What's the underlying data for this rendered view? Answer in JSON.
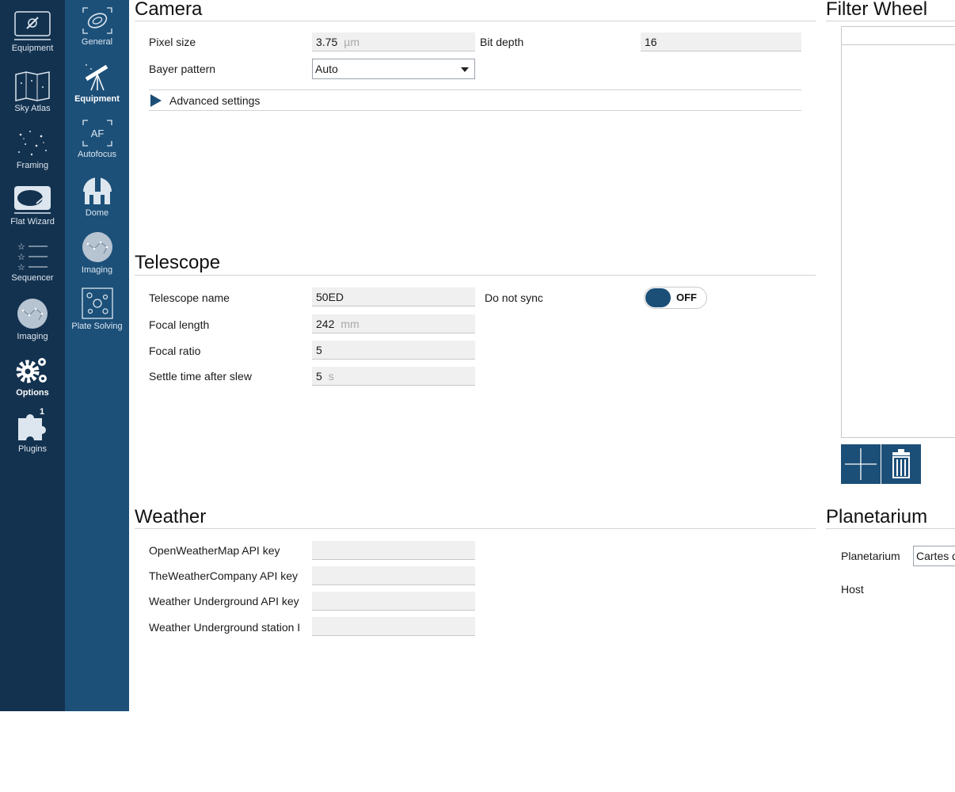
{
  "nav_main": [
    {
      "label": "Equipment",
      "icon": "plug-icon"
    },
    {
      "label": "Sky Atlas",
      "icon": "map-icon"
    },
    {
      "label": "Framing",
      "icon": "stars-icon"
    },
    {
      "label": "Flat Wizard",
      "icon": "flat-wizard-icon"
    },
    {
      "label": "Sequencer",
      "icon": "sequence-list-icon"
    },
    {
      "label": "Imaging",
      "icon": "constellation-icon"
    },
    {
      "label": "Options",
      "icon": "gears-icon",
      "active": true
    },
    {
      "label": "Plugins",
      "icon": "puzzle-icon",
      "badge": "1"
    }
  ],
  "nav_sub": [
    {
      "label": "General",
      "icon": "galaxy-icon"
    },
    {
      "label": "Equipment",
      "icon": "telescope-icon",
      "active": true
    },
    {
      "label": "Autofocus",
      "icon": "autofocus-icon",
      "text": "AF"
    },
    {
      "label": "Dome",
      "icon": "observatory-icon"
    },
    {
      "label": "Imaging",
      "icon": "constellation-icon"
    },
    {
      "label": "Plate Solving",
      "icon": "plate-solve-icon"
    }
  ],
  "camera": {
    "title": "Camera",
    "pixel_size_label": "Pixel size",
    "pixel_size_value": "3.75",
    "pixel_size_unit": "µm",
    "bit_depth_label": "Bit depth",
    "bit_depth_value": "16",
    "bayer_label": "Bayer pattern",
    "bayer_value": "Auto",
    "advanced_label": "Advanced settings"
  },
  "telescope": {
    "title": "Telescope",
    "name_label": "Telescope name",
    "name_value": "50ED",
    "focal_length_label": "Focal length",
    "focal_length_value": "242",
    "focal_length_unit": "mm",
    "focal_ratio_label": "Focal ratio",
    "focal_ratio_value": "5",
    "settle_label": "Settle time after slew",
    "settle_value": "5",
    "settle_unit": "s",
    "do_not_sync_label": "Do not sync",
    "do_not_sync_state": "OFF"
  },
  "weather": {
    "title": "Weather",
    "owm_label": "OpenWeatherMap API key",
    "owm_value": "",
    "twc_label": "TheWeatherCompany API key",
    "twc_value": "",
    "wu_key_label": "Weather Underground API key",
    "wu_key_value": "",
    "wu_station_label": "Weather Underground station I",
    "wu_station_value": ""
  },
  "filter_wheel": {
    "title": "Filter Wheel",
    "add_icon": "plus-icon",
    "delete_icon": "trash-icon"
  },
  "planetarium": {
    "title": "Planetarium",
    "planetarium_label": "Planetarium",
    "planetarium_value": "Cartes d",
    "host_label": "Host"
  },
  "colors": {
    "nav_dark": "#13324f",
    "nav_mid": "#1c5079",
    "accent": "#1c4f78"
  }
}
